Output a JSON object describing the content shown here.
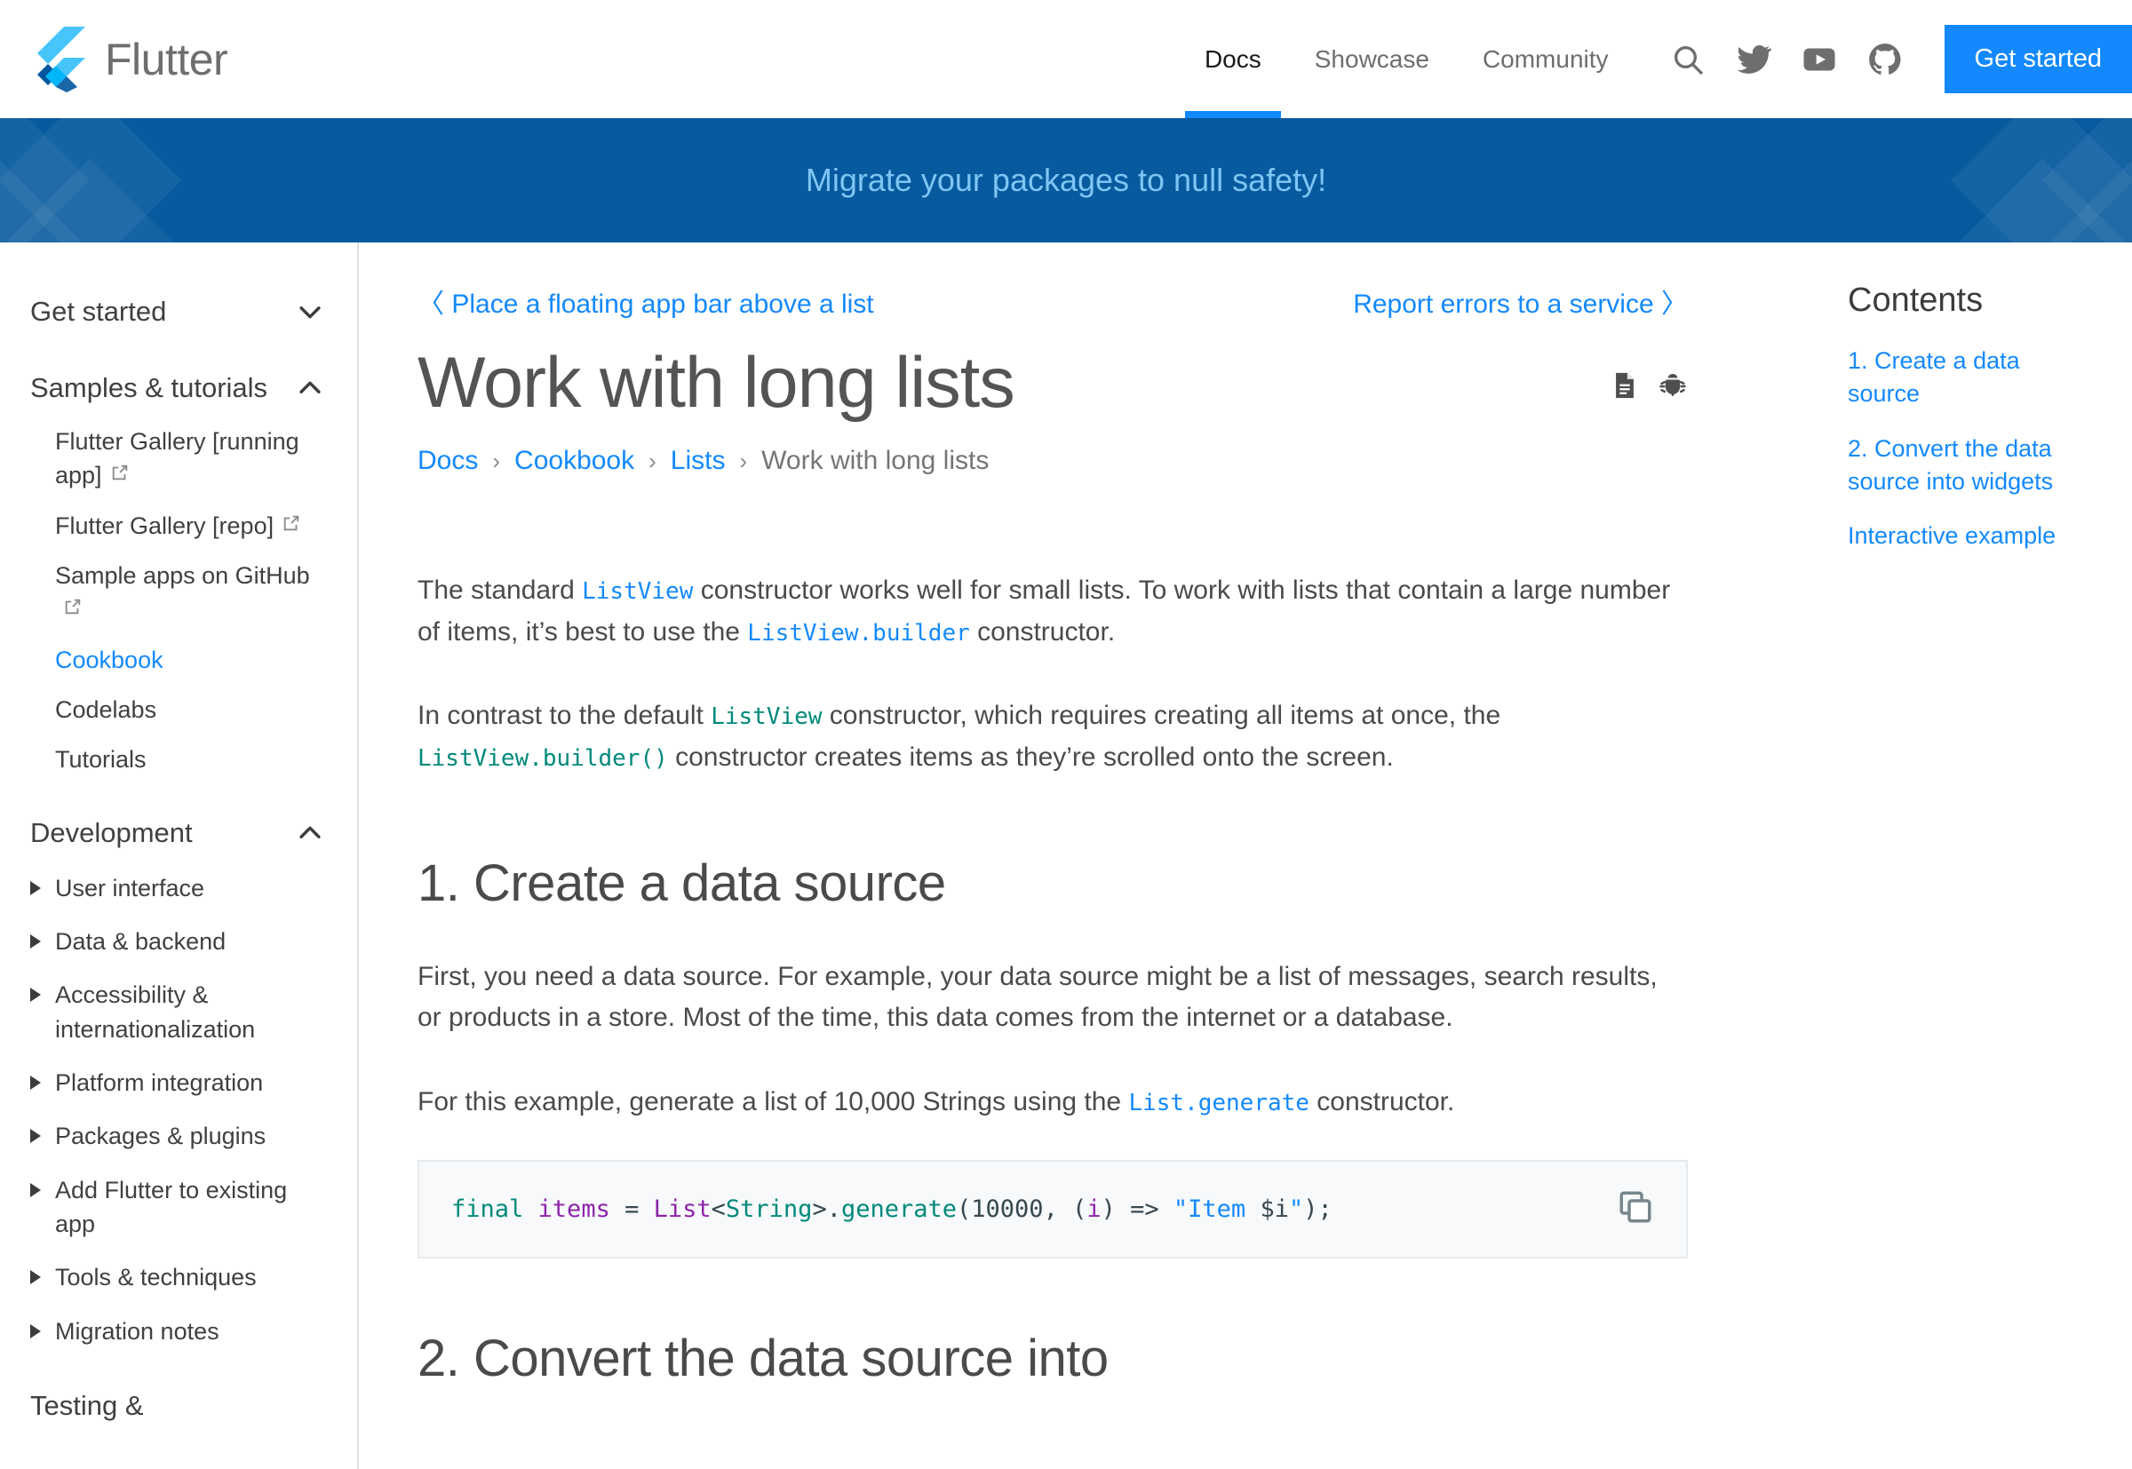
{
  "header": {
    "brand_name": "Flutter",
    "nav": [
      {
        "label": "Docs",
        "active": true
      },
      {
        "label": "Showcase",
        "active": false
      },
      {
        "label": "Community",
        "active": false
      }
    ],
    "icons": [
      "search-icon",
      "twitter-icon",
      "youtube-icon",
      "github-icon"
    ],
    "cta_label": "Get started",
    "accent_color": "#1389fd"
  },
  "banner": {
    "text": "Migrate your packages to null safety!",
    "bg_color": "#075a9e",
    "text_color": "#7ec5f5"
  },
  "sidebar": {
    "groups": [
      {
        "title": "Get started",
        "chevron": "chevron-down-icon",
        "expanded": false,
        "items": []
      },
      {
        "title": "Samples & tutorials",
        "chevron": "chevron-up-icon",
        "expanded": true,
        "items": [
          {
            "label": "Flutter Gallery [running app]",
            "external": true,
            "active": false
          },
          {
            "label": "Flutter Gallery [repo]",
            "external": true,
            "active": false
          },
          {
            "label": "Sample apps on GitHub",
            "external": true,
            "active": false
          },
          {
            "label": "Cookbook",
            "external": false,
            "active": true
          },
          {
            "label": "Codelabs",
            "external": false,
            "active": false
          },
          {
            "label": "Tutorials",
            "external": false,
            "active": false
          }
        ]
      },
      {
        "title": "Development",
        "chevron": "chevron-up-icon",
        "expanded": true,
        "caret_items": [
          "User interface",
          "Data & backend",
          "Accessibility & internationalization",
          "Platform integration",
          "Packages & plugins",
          "Add Flutter to existing app",
          "Tools & techniques",
          "Migration notes"
        ]
      },
      {
        "title": "Testing &",
        "chevron": "",
        "expanded": false,
        "items": []
      }
    ]
  },
  "main": {
    "prev_link": "〈 Place a floating app bar above a list",
    "next_link": "Report errors to a service 〉",
    "title": "Work with long lists",
    "title_actions": [
      "document-icon",
      "bug-icon"
    ],
    "breadcrumb": [
      {
        "label": "Docs",
        "link": true
      },
      {
        "label": "Cookbook",
        "link": true
      },
      {
        "label": "Lists",
        "link": true
      },
      {
        "label": "Work with long lists",
        "link": false
      }
    ],
    "breadcrumb_separator": "›",
    "para1": {
      "t1": "The standard ",
      "c1": "ListView",
      "t2": " constructor works well for small lists. To work with lists that contain a large number of items, it’s best to use the ",
      "c2": "ListView.builder",
      "t3": " constructor."
    },
    "para2": {
      "t1": "In contrast to the default ",
      "c1": "ListView",
      "t2": " constructor, which requires creating all items at once, the ",
      "c2": "ListView.builder()",
      "t3": " constructor creates items as they’re scrolled onto the screen."
    },
    "section1_heading": "1. Create a data source",
    "para3": "First, you need a data source. For example, your data source might be a list of messages, search results, or products in a store. Most of the time, this data comes from the internet or a database.",
    "para4": {
      "t1": "For this example, generate a list of 10,000 Strings using the ",
      "c1": "List.generate",
      "t2": " constructor."
    },
    "code": {
      "copy_icon": "copy-icon",
      "tokens": [
        {
          "text": "final",
          "type": "kw"
        },
        {
          "text": " ",
          "type": "pun"
        },
        {
          "text": "items",
          "type": "var"
        },
        {
          "text": " = ",
          "type": "pun"
        },
        {
          "text": "List",
          "type": "cls"
        },
        {
          "text": "<",
          "type": "pun"
        },
        {
          "text": "String",
          "type": "typ"
        },
        {
          "text": ">.",
          "type": "pun"
        },
        {
          "text": "generate",
          "type": "typ"
        },
        {
          "text": "(",
          "type": "pun"
        },
        {
          "text": "10000",
          "type": "num"
        },
        {
          "text": ", (",
          "type": "pun"
        },
        {
          "text": "i",
          "type": "var"
        },
        {
          "text": ") => ",
          "type": "pun"
        },
        {
          "text": "\"Item ",
          "type": "str"
        },
        {
          "text": "$i",
          "type": "pun"
        },
        {
          "text": "\"",
          "type": "str"
        },
        {
          "text": ");",
          "type": "pun"
        }
      ]
    },
    "section2_heading": "2. Convert the data source into"
  },
  "toc": {
    "title": "Contents",
    "items": [
      "1. Create a data source",
      "2. Convert the data source into widgets",
      "Interactive example"
    ]
  }
}
